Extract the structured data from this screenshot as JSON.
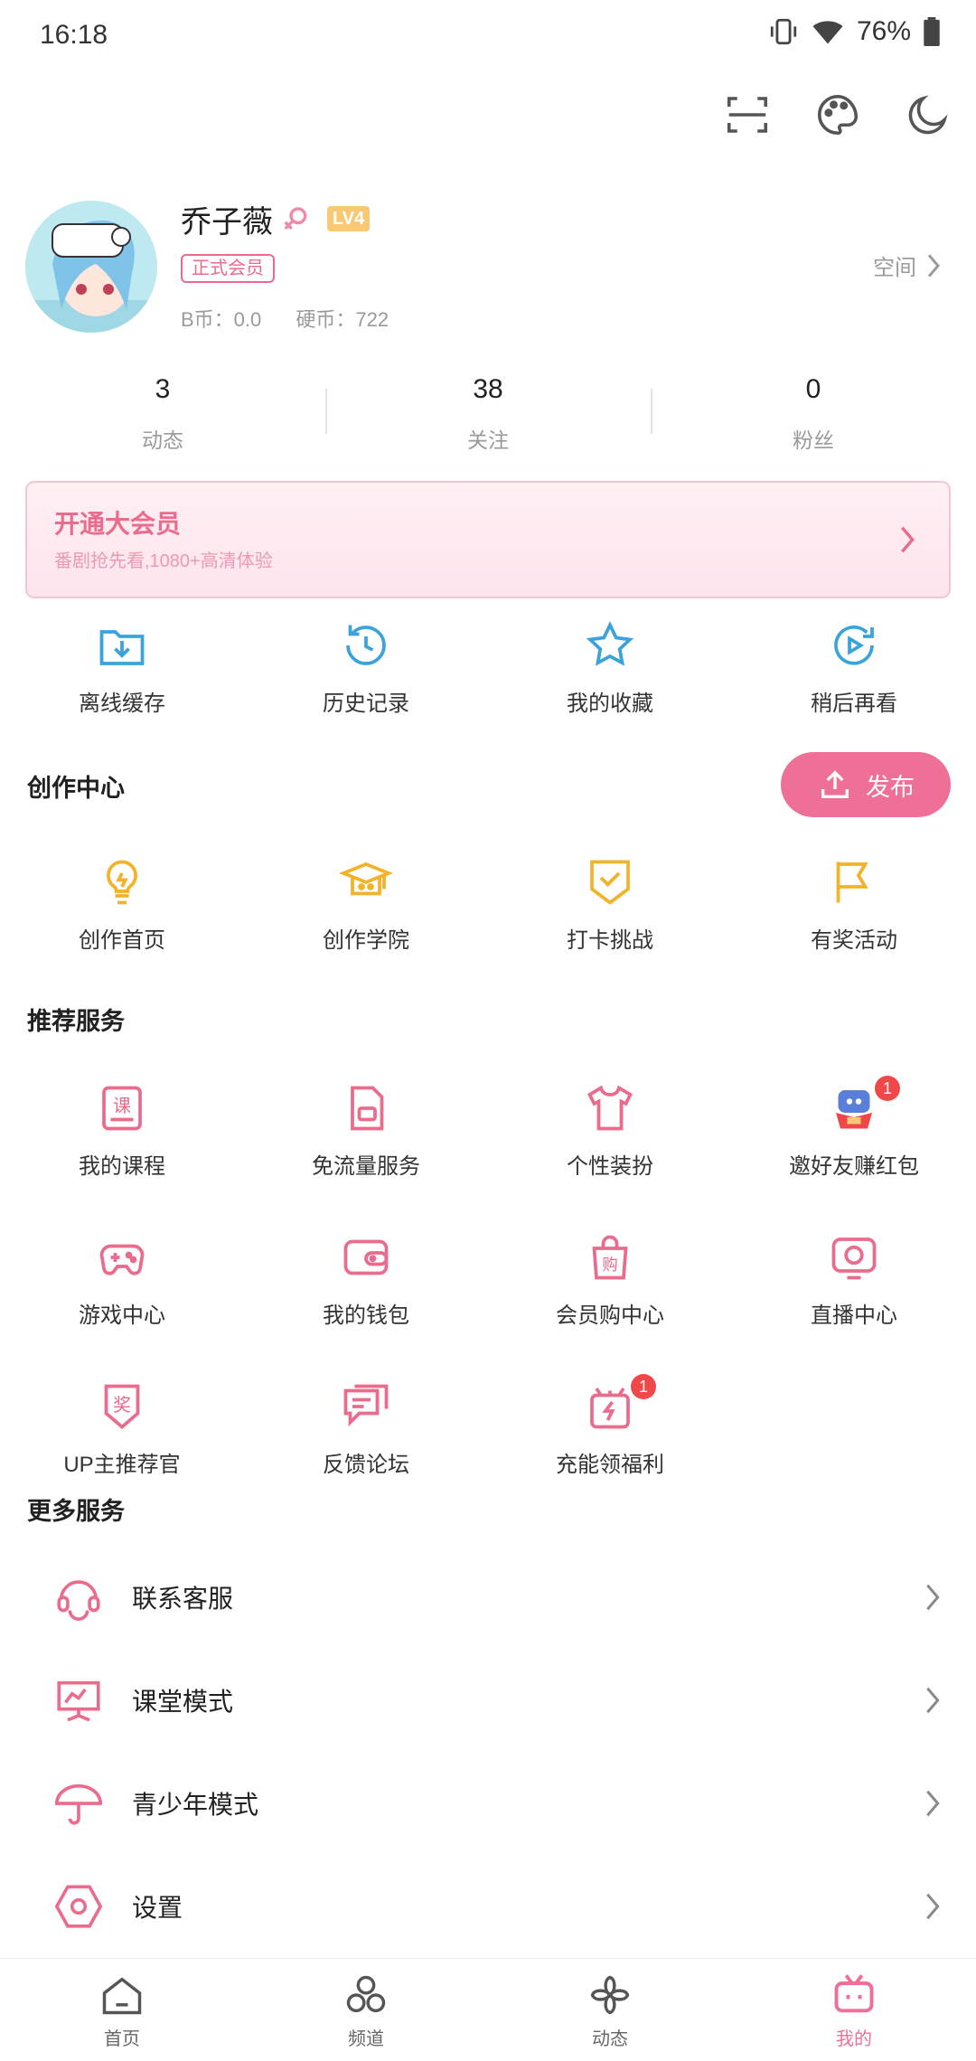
{
  "status_bar": {
    "time": "16:18",
    "battery": "76%"
  },
  "profile": {
    "name": "乔子薇",
    "level": "LV4",
    "vip_status": "正式会员",
    "b_coin": "B币：0.0",
    "coin": "硬币：722",
    "space_link": "空间"
  },
  "stats": [
    {
      "value": "3",
      "label": "动态"
    },
    {
      "value": "38",
      "label": "关注"
    },
    {
      "value": "0",
      "label": "粉丝"
    }
  ],
  "vip_banner": {
    "title": "开通大会员",
    "subtitle": "番剧抢先看,1080+高清体验"
  },
  "quick_actions": [
    {
      "label": "离线缓存"
    },
    {
      "label": "历史记录"
    },
    {
      "label": "我的收藏"
    },
    {
      "label": "稍后再看"
    }
  ],
  "creation": {
    "title": "创作中心",
    "publish_label": "发布",
    "items": [
      {
        "label": "创作首页"
      },
      {
        "label": "创作学院"
      },
      {
        "label": "打卡挑战"
      },
      {
        "label": "有奖活动"
      }
    ]
  },
  "recommended": {
    "title": "推荐服务",
    "items": [
      {
        "label": "我的课程"
      },
      {
        "label": "免流量服务"
      },
      {
        "label": "个性装扮"
      },
      {
        "label": "邀好友赚红包",
        "badge": "1"
      },
      {
        "label": "游戏中心"
      },
      {
        "label": "我的钱包"
      },
      {
        "label": "会员购中心"
      },
      {
        "label": "直播中心"
      },
      {
        "label": "UP主推荐官"
      },
      {
        "label": "反馈论坛"
      },
      {
        "label": "充能领福利",
        "badge": "1"
      }
    ]
  },
  "more_services": {
    "title": "更多服务",
    "items": [
      {
        "label": "联系客服"
      },
      {
        "label": "课堂模式"
      },
      {
        "label": "青少年模式"
      },
      {
        "label": "设置"
      }
    ]
  },
  "bottom_nav": [
    {
      "label": "首页"
    },
    {
      "label": "频道"
    },
    {
      "label": "动态"
    },
    {
      "label": "我的"
    }
  ],
  "colors": {
    "accent_pink": "#ef7096",
    "creation_yellow": "#f2b328",
    "quick_blue": "#3aa3d9"
  }
}
